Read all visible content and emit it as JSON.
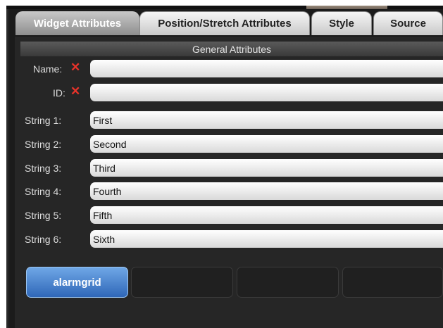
{
  "tabs": [
    {
      "label": "Widget Attributes",
      "active": true
    },
    {
      "label": "Position/Stretch Attributes",
      "active": false
    },
    {
      "label": "Style",
      "active": false
    },
    {
      "label": "Source",
      "active": false
    }
  ],
  "section": {
    "title": "General Attributes"
  },
  "fields": {
    "name": {
      "label": "Name:",
      "value": "",
      "error_icon": "x-icon"
    },
    "id": {
      "label": "ID:",
      "value": "",
      "error_icon": "x-icon"
    },
    "strings": [
      {
        "label": "String 1:",
        "value": "First"
      },
      {
        "label": "String 2:",
        "value": "Second"
      },
      {
        "label": "String 3:",
        "value": "Third"
      },
      {
        "label": "String 4:",
        "value": "Fourth"
      },
      {
        "label": "String 5:",
        "value": "Fifth"
      },
      {
        "label": "String 6:",
        "value": "Sixth"
      }
    ]
  },
  "widget_buttons": [
    {
      "label": "alarmgrid",
      "selected": true
    },
    {
      "label": "",
      "selected": false
    },
    {
      "label": "",
      "selected": false
    },
    {
      "label": "",
      "selected": false
    }
  ],
  "colors": {
    "accent": "#3f7fd0",
    "error": "#e8332a",
    "background": "#262626"
  }
}
